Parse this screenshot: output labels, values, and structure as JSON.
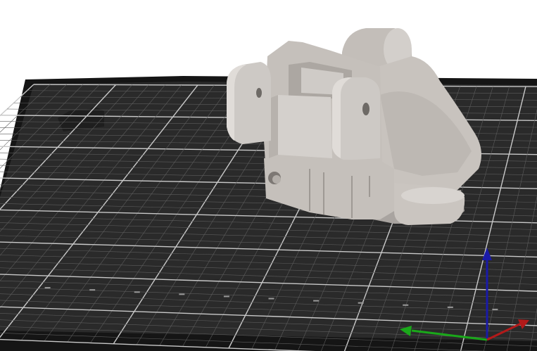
{
  "viewport": {
    "background_color": "#ffffff",
    "bed_color": "#2a2a2a",
    "bed_edge_color": "#151515",
    "grid_minor_color": "#5d5d5d",
    "grid_major_color": "#c9c9c9",
    "model_color": "#c8c3be",
    "model_shadow_color": "#8f8a86",
    "model_highlight_color": "#dcd8d4"
  },
  "axes": {
    "z_color": "#1a1aa8",
    "y_color": "#1aa81a",
    "x_color": "#b21a1a"
  }
}
